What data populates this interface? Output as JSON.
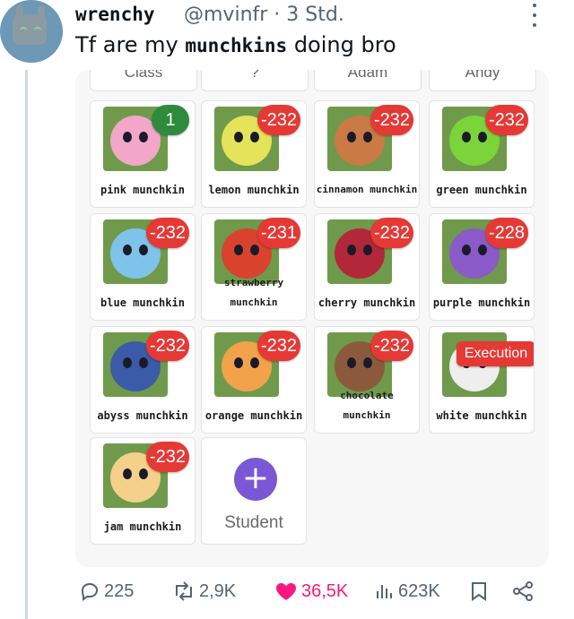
{
  "author": {
    "name": "wrenchy",
    "handle": "@mvinfr",
    "separator": "·",
    "time": "3 Std."
  },
  "tweet": {
    "text_before": "Tf are my ",
    "text_bold": "munchkins",
    "text_after": " doing bro"
  },
  "media": {
    "column_headers": [
      "Class",
      "?",
      "Adam",
      "Andy"
    ],
    "cards": [
      {
        "name": "pink munchkin",
        "badge": "1",
        "badge_color": "#2e8b3c",
        "ball_color": "#f2a6c8"
      },
      {
        "name": "lemon munchkin",
        "badge": "-232",
        "badge_color": "#e53935",
        "ball_color": "#e4e35a"
      },
      {
        "name": "cinnamon munchkin",
        "badge": "-232",
        "badge_color": "#e53935",
        "ball_color": "#c97a45"
      },
      {
        "name": "green munchkin",
        "badge": "-232",
        "badge_color": "#e53935",
        "ball_color": "#7bd43a"
      },
      {
        "name": "blue munchkin",
        "badge": "-232",
        "badge_color": "#e53935",
        "ball_color": "#7fc3ea"
      },
      {
        "name": "strawberry munchkin",
        "badge": "-231",
        "badge_color": "#e53935",
        "ball_color": "#d9432e"
      },
      {
        "name": "cherry munchkin",
        "badge": "-232",
        "badge_color": "#e53935",
        "ball_color": "#b3273a"
      },
      {
        "name": "purple munchkin",
        "badge": "-228",
        "badge_color": "#e53935",
        "ball_color": "#8a5bc8"
      },
      {
        "name": "abyss munchkin",
        "badge": "-232",
        "badge_color": "#e53935",
        "ball_color": "#3b5aa8"
      },
      {
        "name": "orange munchkin",
        "badge": "-232",
        "badge_color": "#e53935",
        "ball_color": "#f2a24a"
      },
      {
        "name": "chocolate munchkin",
        "badge": "-232",
        "badge_color": "#e53935",
        "ball_color": "#8b5a3c"
      },
      {
        "name": "white munchkin",
        "badge": "Execution",
        "badge_color": "#e53935",
        "ball_color": "#eeeeee"
      },
      {
        "name": "jam munchkin",
        "badge": "-232",
        "badge_color": "#e53935",
        "ball_color": "#f4d08a"
      }
    ],
    "add_button": {
      "icon": "+",
      "label": "Student"
    }
  },
  "actions": {
    "replies": "225",
    "reposts": "2,9K",
    "likes": "36,5K",
    "views": "623K"
  },
  "colors": {
    "like": "#f91880",
    "muted": "#536471",
    "add_button": "#7b57d6",
    "badge_red": "#e53935"
  }
}
